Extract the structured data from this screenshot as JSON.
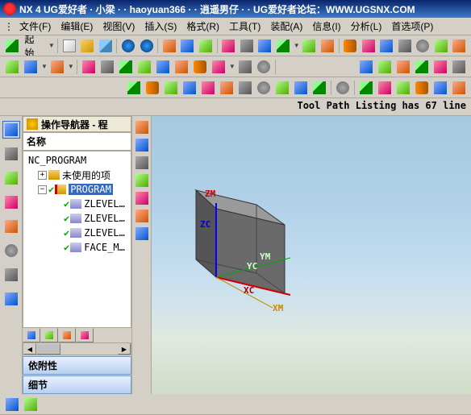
{
  "title_bar": {
    "text": "NX 4 UG爱好者 · 小梁 · · haoyuan366 · · 逍遥男仔 · · UG爱好者论坛：WWW.UGSNX.COM"
  },
  "menu": {
    "items": [
      "文件(F)",
      "编辑(E)",
      "视图(V)",
      "插入(S)",
      "格式(R)",
      "工具(T)",
      "装配(A)",
      "信息(I)",
      "分析(L)",
      "首选项(P)"
    ]
  },
  "toolbar1": {
    "start_label": "起始"
  },
  "status": {
    "text": "Tool Path Listing has 67 line"
  },
  "navigator": {
    "title": "操作导航器 - 程",
    "header": "名称",
    "root": "NC_PROGRAM",
    "unused": "未使用的项",
    "program": "PROGRAM",
    "ops": [
      "ZLEVEL…",
      "ZLEVEL…",
      "ZLEVEL…",
      "FACE_M…"
    ]
  },
  "panels": {
    "dependency": "依附性",
    "detail": "细节"
  },
  "axes": {
    "zm": "ZM",
    "zc": "ZC",
    "yc": "YC",
    "ym": "YM",
    "xc": "XC",
    "xm": "XM"
  }
}
